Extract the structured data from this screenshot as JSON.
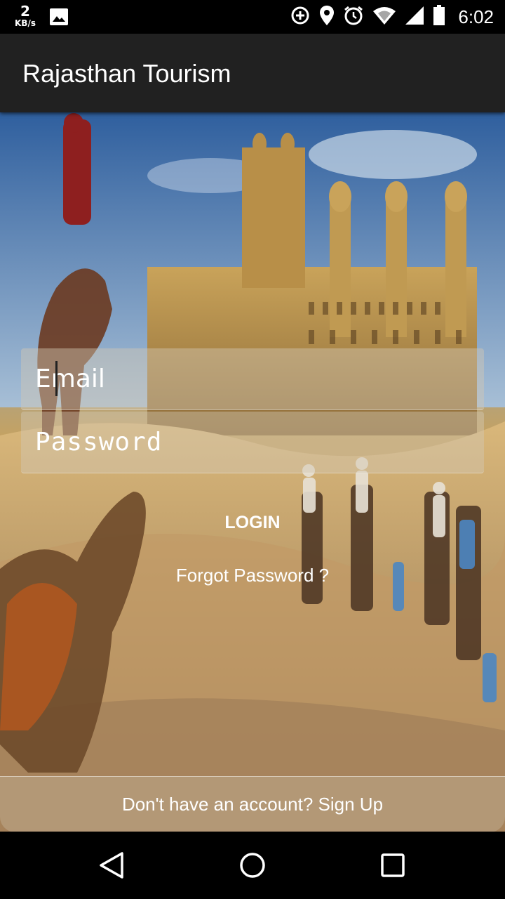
{
  "status_bar": {
    "net_speed_value": "2",
    "net_speed_unit": "KB/s",
    "time": "6:02",
    "icons": [
      "image-icon",
      "data-saver-icon",
      "location-icon",
      "alarm-icon",
      "wifi-icon",
      "signal-icon",
      "battery-icon"
    ]
  },
  "app_bar": {
    "title": "Rajasthan Tourism"
  },
  "form": {
    "email_placeholder": "Email",
    "email_value": "",
    "password_placeholder": "Password",
    "password_value": "",
    "login_label": "LOGIN",
    "forgot_label": "Forgot Password ?"
  },
  "signup": {
    "label": "Don't have an account? Sign Up"
  },
  "nav_bar": {
    "icons": [
      "back-icon",
      "home-icon",
      "recents-icon"
    ]
  },
  "colors": {
    "app_bar": "#212121",
    "status_bar": "#000000",
    "text": "#ffffff"
  }
}
